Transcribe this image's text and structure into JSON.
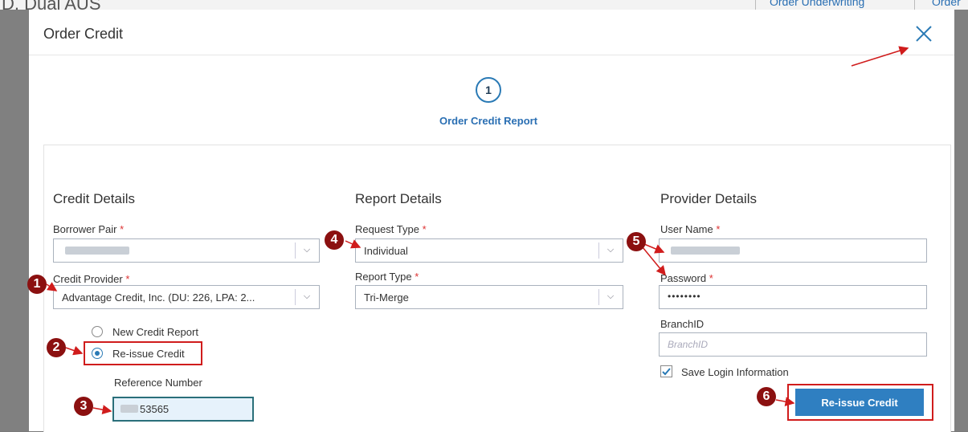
{
  "background": {
    "title": "D. Dual AUS",
    "tabs": [
      "Order Underwriting",
      "Order Cre"
    ]
  },
  "modal": {
    "title": "Order Credit",
    "close_icon": "close-icon"
  },
  "stepper": {
    "step_number": "1",
    "step_label": "Order Credit Report"
  },
  "credit_details": {
    "title": "Credit Details",
    "borrower_pair_label": "Borrower Pair",
    "credit_provider_label": "Credit Provider",
    "credit_provider_value": "Advantage Credit, Inc. (DU: 226, LPA: 2...",
    "radio_new_label": "New Credit Report",
    "radio_reissue_label": "Re-issue Credit",
    "reissue_selected": true,
    "reference_number_label": "Reference Number",
    "reference_number_value": "53565"
  },
  "report_details": {
    "title": "Report Details",
    "request_type_label": "Request Type",
    "request_type_value": "Individual",
    "report_type_label": "Report Type",
    "report_type_value": "Tri-Merge"
  },
  "provider_details": {
    "title": "Provider Details",
    "user_name_label": "User Name",
    "password_label": "Password",
    "password_value": "••••••••",
    "branch_id_label": "BranchID",
    "branch_id_placeholder": "BranchID",
    "save_login_label": "Save Login Information",
    "save_login_checked": true
  },
  "required_mark": "*",
  "actions": {
    "primary_label": "Re-issue Credit"
  },
  "annotations": [
    "1",
    "2",
    "3",
    "4",
    "5",
    "6"
  ],
  "colors": {
    "accent": "#2f7fc1",
    "annotation_red": "#d01c1c",
    "badge": "#8b1010"
  }
}
